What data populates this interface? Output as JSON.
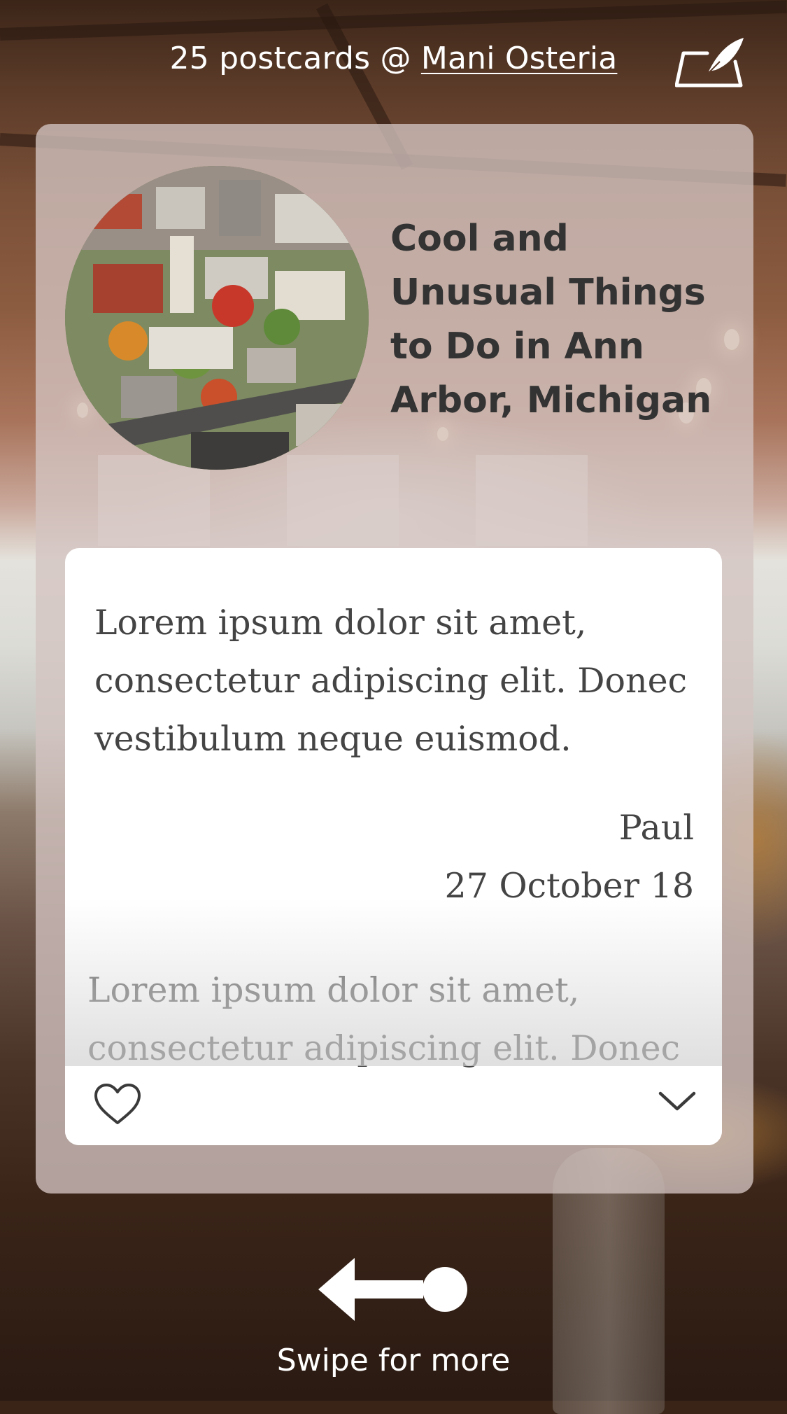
{
  "header": {
    "postcard_count_text": "25 postcards @ ",
    "venue_name": "Mani Osteria",
    "write_icon": "write-postcard-icon"
  },
  "place": {
    "photo_icon": "aerial-city-photo",
    "title": "Cool and Unusual Things to Do in Ann Arbor, Michigan"
  },
  "postcard": {
    "message": "Lorem ipsum dolor sit amet, consectetur adipiscing elit. Donec vestibulum neque euismod.",
    "author": "Paul",
    "date": "27 October 18",
    "next_message_preview": "Lorem ipsum dolor sit amet, consectetur adipiscing elit. Donec",
    "like_icon": "heart-icon",
    "expand_icon": "chevron-down-icon"
  },
  "swipe": {
    "icon": "swipe-left-arrow-icon",
    "label": "Swipe for more"
  },
  "colors": {
    "card_overlay": "#d4c4c2",
    "postcard_bg": "#ffffff",
    "title_text": "#333333",
    "body_text": "#444444",
    "header_text": "#ffffff"
  }
}
